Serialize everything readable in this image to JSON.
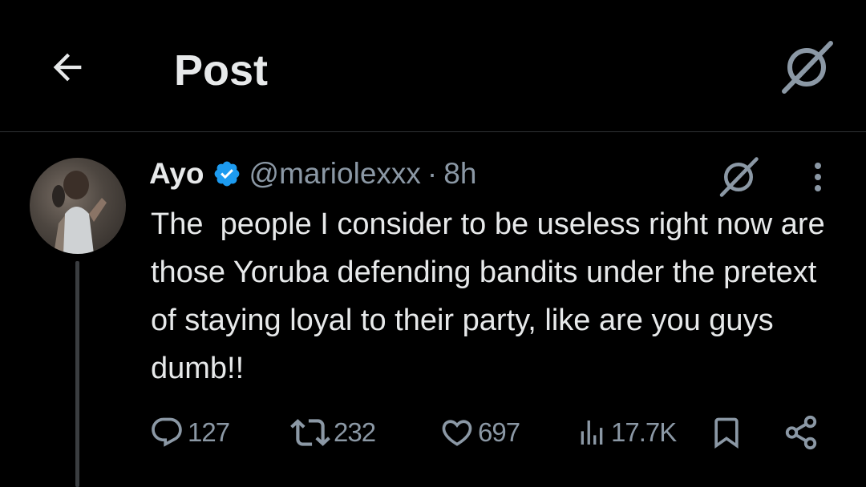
{
  "header": {
    "title": "Post",
    "back_icon": "arrow-left-icon",
    "grok_icon": "grok-icon"
  },
  "post": {
    "author_name": "Ayo",
    "verified": true,
    "handle": "@mariolexxx",
    "separator": "·",
    "time": "8h",
    "text": "The  people I consider to be useless right now are those Yoruba defending bandits under the pretext of staying loyal to their party, like are you guys dumb!!",
    "actions": {
      "replies": "127",
      "reposts": "232",
      "likes": "697",
      "views": "17.7K"
    }
  },
  "colors": {
    "background": "#000000",
    "text": "#e7e9ea",
    "secondary": "#8b98a5",
    "verified": "#1d9bf0",
    "divider": "#2f3336"
  }
}
